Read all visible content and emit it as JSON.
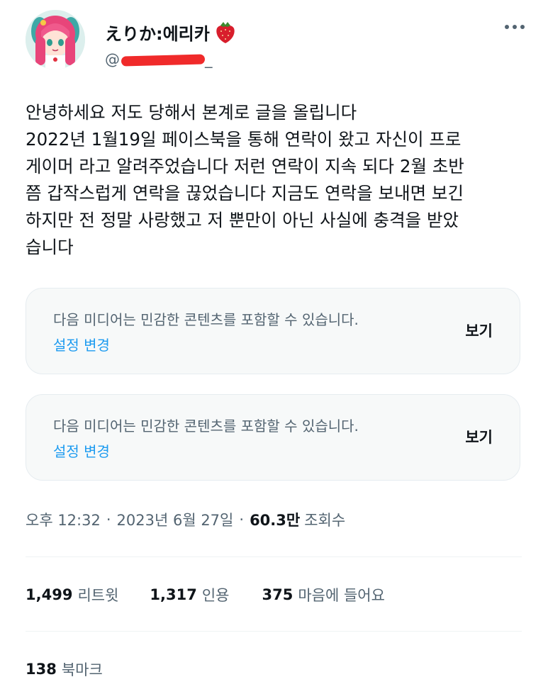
{
  "author": {
    "display_name": "えりか:에리카",
    "handle_prefix": "@",
    "handle_suffix": "_"
  },
  "tweet": {
    "lines": [
      "안녕하세요 저도 당해서 본계로 글을 올립니다",
      "2022년 1월19일 페이스북을 통해 연락이 왔고 자신이 프로",
      "게이머 라고 알려주었습니다 저런 연락이 지속 되다 2월 초반",
      "쯤 갑작스럽게 연락을 끊었습니다 지금도 연락을 보내면 보긴",
      "하지만 전 정말 사랑했고 저 뿐만이 아닌 사실에 충격을 받았",
      "습니다"
    ]
  },
  "media": [
    {
      "warning": "다음 미디어는 민감한 콘텐츠를 포함할 수 있습니다.",
      "settings_label": "설정 변경",
      "view_label": "보기"
    },
    {
      "warning": "다음 미디어는 민감한 콘텐츠를 포함할 수 있습니다.",
      "settings_label": "설정 변경",
      "view_label": "보기"
    }
  ],
  "meta": {
    "time": "오후 12:32",
    "separator": "·",
    "date": "2023년 6월 27일",
    "views_count": "60.3만",
    "views_label": "조회수"
  },
  "stats": {
    "retweets": {
      "count": "1,499",
      "label": "리트윗"
    },
    "quotes": {
      "count": "1,317",
      "label": "인용"
    },
    "likes": {
      "count": "375",
      "label": "마음에 들어요"
    },
    "bookmarks": {
      "count": "138",
      "label": "북마크"
    }
  },
  "icons": {
    "header": [
      "avatar",
      "strawberry-emoji-icon",
      "more-options-icon"
    ]
  },
  "colors": {
    "link": "#1d9bf0",
    "secondary_text": "#536471",
    "primary_text": "#0f1419",
    "redaction": "#f02a2a",
    "card_background": "#f7f9f9"
  }
}
